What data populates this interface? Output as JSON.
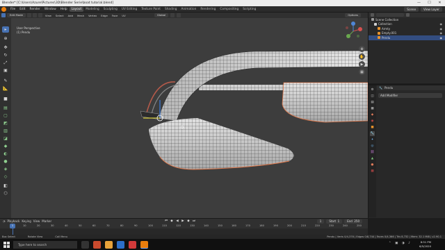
{
  "window": {
    "title": "Blender* [C:\\Users\\Azure\\Pictures\\3D\\Blender Serie\\boat tutorial.blend]",
    "controls": [
      "—",
      "☐",
      "✕"
    ]
  },
  "menu": [
    "File",
    "Edit",
    "Render",
    "Window",
    "Help"
  ],
  "workspaces": [
    "Layout",
    "Modeling",
    "Sculpting",
    "UV Editing",
    "Texture Paint",
    "Shading",
    "Animation",
    "Rendering",
    "Compositing",
    "Scripting"
  ],
  "active_workspace": "Layout",
  "scene": {
    "name": "Scene",
    "view_layer": "View Layer"
  },
  "viewport_header": {
    "mode": "Edit Mode",
    "menus": [
      "View",
      "Select",
      "Add",
      "Mesh",
      "Vertex",
      "Edge",
      "Face",
      "UV"
    ],
    "orientation": "Global",
    "options": "Options"
  },
  "viewport": {
    "perspective": "User Perspective",
    "object": "(1) Pendu"
  },
  "outliner": {
    "title": "Scene Collection",
    "rows": [
      {
        "label": "Scene Collection",
        "color": "#9a9a9a",
        "selected": false
      },
      {
        "label": "Collection",
        "color": "#d0d0d0",
        "selected": false
      },
      {
        "label": "Armty",
        "color": "#e8932c",
        "selected": false
      },
      {
        "label": "Empty.001",
        "color": "#e8932c",
        "selected": false
      },
      {
        "label": "Pendu",
        "color": "#e8932c",
        "selected": true
      }
    ]
  },
  "properties": {
    "object_name": "Pendu",
    "add_modifier": "Add Modifier"
  },
  "timeline": {
    "menus": [
      "Playback",
      "Keying",
      "View",
      "Marker"
    ],
    "current_frame": "1",
    "start_label": "Start",
    "start": "1",
    "end_label": "End",
    "end": "250",
    "ticks": [
      "10",
      "20",
      "30",
      "40",
      "50",
      "60",
      "70",
      "80",
      "90",
      "100",
      "110",
      "120",
      "130",
      "140",
      "150",
      "160",
      "170",
      "180",
      "190",
      "200",
      "210",
      "220",
      "230",
      "240",
      "250"
    ]
  },
  "status": {
    "select": "Box Select",
    "rotate": "Rotate View",
    "menu": "Call Menu",
    "stats": "Pendu | Verts 0/4,378 | Edges 0/8,744 | Faces 0/4,366 | Tris 8,732 | Mem: 32.1 MiB | v2.90.1"
  },
  "taskbar": {
    "search": "Type here to search",
    "time": "8:51 PM",
    "date": "6/5/2020"
  },
  "colors": {
    "accent": "#4772b3",
    "blender_orange": "#e87d0d",
    "viewport_bg": "#3d3d3d"
  }
}
